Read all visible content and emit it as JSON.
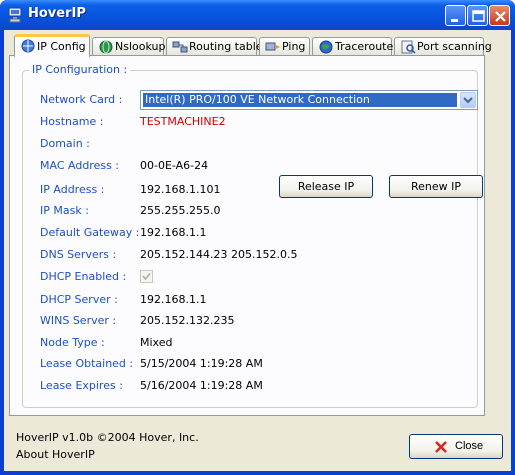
{
  "window": {
    "title": "HoverIP",
    "colors": {
      "titlebar": "#0853de",
      "accent_label": "#1d4fc4",
      "hostname": "#d40000",
      "active_tab_marker": "#ffc83c"
    }
  },
  "tabs": [
    {
      "label": "IP Config",
      "icon": "network-icon",
      "active": true
    },
    {
      "label": "Nslookup",
      "icon": "globe-icon"
    },
    {
      "label": "Routing table",
      "icon": "routing-icon"
    },
    {
      "label": "Ping",
      "icon": "ping-icon"
    },
    {
      "label": "Traceroute",
      "icon": "globe-icon"
    },
    {
      "label": "Port scanning",
      "icon": "scan-icon"
    }
  ],
  "ip_config": {
    "group_title": "IP Configuration :",
    "fields": {
      "network_card": {
        "label": "Network Card :",
        "value": "Intel(R) PRO/100 VE Network Connection"
      },
      "hostname": {
        "label": "Hostname :",
        "value": "TESTMACHINE2"
      },
      "domain": {
        "label": "Domain :",
        "value": ""
      },
      "mac": {
        "label": "MAC Address :",
        "value": "00-0E-A6-24"
      },
      "ip": {
        "label": "IP Address :",
        "value": "192.168.1.101"
      },
      "mask": {
        "label": "IP Mask :",
        "value": "255.255.255.0"
      },
      "gateway": {
        "label": "Default Gateway :",
        "value": "192.168.1.1"
      },
      "dns": {
        "label": "DNS Servers :",
        "value": "205.152.144.23 205.152.0.5"
      },
      "dhcp_enabled": {
        "label": "DHCP Enabled :",
        "checked": true
      },
      "dhcp_server": {
        "label": "DHCP Server :",
        "value": "192.168.1.1"
      },
      "wins": {
        "label": "WINS Server :",
        "value": "205.152.132.235"
      },
      "node_type": {
        "label": "Node Type :",
        "value": "Mixed"
      },
      "lease_obtained": {
        "label": "Lease Obtained :",
        "value": "5/15/2004 1:19:28 AM"
      },
      "lease_expires": {
        "label": "Lease Expires :",
        "value": "5/16/2004 1:19:28 AM"
      }
    },
    "buttons": {
      "release": "Release IP",
      "renew": "Renew IP"
    }
  },
  "footer": {
    "copyright": "HoverIP v1.0b ©2004 Hover, Inc.",
    "about": "About HoverIP",
    "close_label": "Close"
  }
}
